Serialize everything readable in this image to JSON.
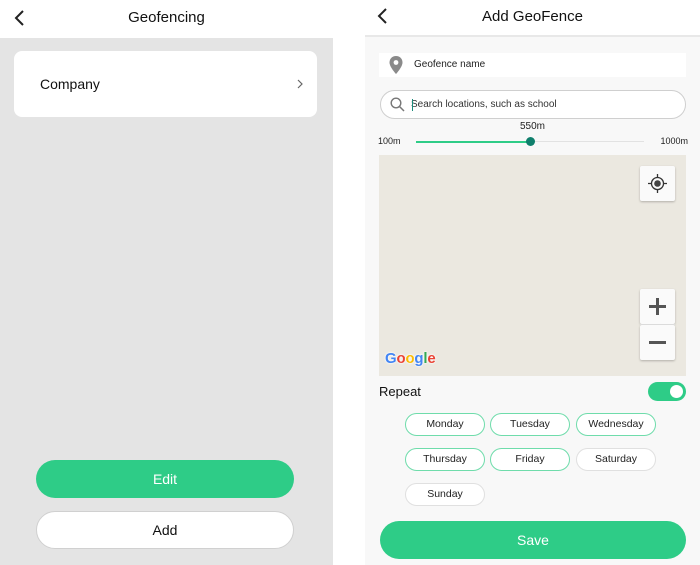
{
  "left_screen": {
    "header": {
      "title": "Geofencing",
      "back_icon": "chevron-left-icon"
    },
    "fences": [
      {
        "label": "Company",
        "icon": "chevron-right-icon"
      }
    ],
    "buttons": {
      "edit": "Edit",
      "add": "Add"
    }
  },
  "right_screen": {
    "header": {
      "title": "Add GeoFence",
      "back_icon": "chevron-left-icon"
    },
    "name_field": {
      "placeholder": "Geofence name",
      "icon": "map-pin-icon"
    },
    "search": {
      "placeholder": "Search locations, such as school",
      "icon": "search-icon"
    },
    "radius_slider": {
      "value_label": "550m",
      "min_label": "100m",
      "max_label": "1000m",
      "min": 100,
      "max": 1000,
      "value": 550
    },
    "map": {
      "attribution": "Google",
      "locate_icon": "crosshair-icon",
      "zoom_in_icon": "plus-icon",
      "zoom_out_icon": "minus-icon"
    },
    "repeat": {
      "label": "Repeat",
      "enabled": true
    },
    "days": [
      {
        "label": "Monday",
        "selected": true
      },
      {
        "label": "Tuesday",
        "selected": true
      },
      {
        "label": "Wednesday",
        "selected": true
      },
      {
        "label": "Thursday",
        "selected": true
      },
      {
        "label": "Friday",
        "selected": true
      },
      {
        "label": "Saturday",
        "selected": false
      },
      {
        "label": "Sunday",
        "selected": false
      }
    ],
    "save_label": "Save"
  },
  "colors": {
    "accent": "#2ecc87",
    "slider_thumb": "#0f7f6c",
    "day_selected_border": "#6fdcab",
    "map_bg": "#ebe8e0"
  }
}
